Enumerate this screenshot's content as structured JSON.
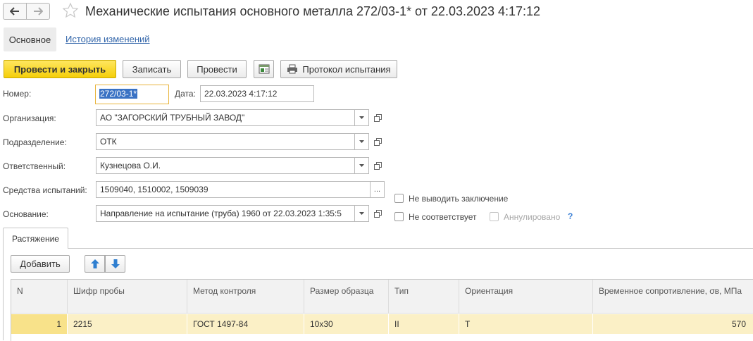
{
  "window": {
    "title": "Механические испытания основного металла 272/03-1* от 22.03.2023 4:17:12"
  },
  "tabs": [
    {
      "label": "Основное"
    },
    {
      "label": "История изменений"
    }
  ],
  "toolbar": {
    "post_and_close": "Провести и закрыть",
    "save": "Записать",
    "post": "Провести",
    "report": "Протокол испытания"
  },
  "form": {
    "number_label": "Номер:",
    "number_value": "272/03-1*",
    "date_label": "Дата:",
    "date_value": "22.03.2023  4:17:12",
    "org_label": "Организация:",
    "org_value": "АО \"ЗАГОРСКИЙ ТРУБНЫЙ ЗАВОД\"",
    "dept_label": "Подразделение:",
    "dept_value": "ОТК",
    "resp_label": "Ответственный:",
    "resp_value": "Кузнецова О.И.",
    "means_label": "Средства испытаний:",
    "means_value": "1509040, 1510002, 1509039",
    "means_button": "...",
    "basis_label": "Основание:",
    "basis_value": "Направление на испытание (труба) 1960 от 22.03.2023 1:35:5",
    "no_conclusion": "Не выводить заключение",
    "not_compliant": "Не соответствует",
    "cancelled": "Аннулировано",
    "help": "?"
  },
  "inner_tab": {
    "label": "Растяжение",
    "add": "Добавить"
  },
  "table": {
    "columns": [
      "N",
      "Шифр пробы",
      "Метод контроля",
      "Размер образца",
      "Тип",
      "Ориентация",
      "Временное сопротивление, σв, МПа"
    ],
    "rows": [
      [
        "1",
        "2215",
        "ГОСТ 1497-84",
        "10x30",
        "II",
        "T",
        "570"
      ]
    ]
  },
  "colors": {
    "primary_button": "#f5cf09",
    "selected_row": "#fbf0c6",
    "link": "#3366aa",
    "focus_border": "#e8b43c"
  }
}
